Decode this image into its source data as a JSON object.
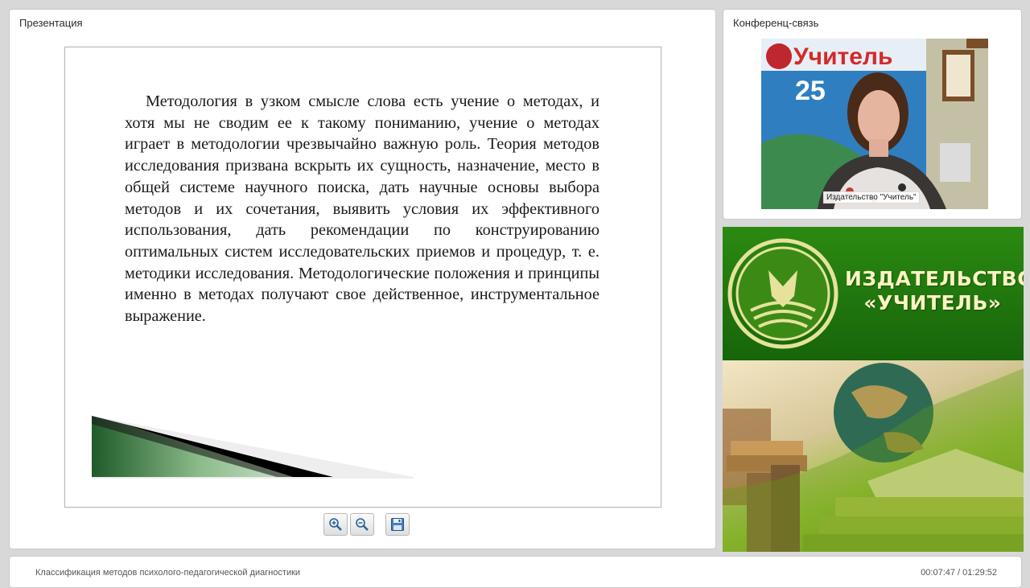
{
  "presentation": {
    "title": "Презентация",
    "slide_text": "Методология в узком смысле слова есть учение о методах, и хотя мы не сводим ее к такому пониманию, учение о методах играет в методологии чрезвычайно важную роль. Теория методов исследования призвана вскрыть их сущность, назначение, место в общей системе научного поиска, дать научные основы выбора методов и их сочетания, выявить условия их эффективного использования, дать рекомендации по конструированию оптимальных систем исследовательских приемов и процедур, т. е. методики исследования. Методологические положения и принципы именно в методах получают свое действенное, инструментальное выражение.",
    "toolbar": [
      {
        "name": "zoom-in",
        "icon": "zoom-in-icon"
      },
      {
        "name": "zoom-out",
        "icon": "zoom-out-icon"
      },
      {
        "name": "save",
        "icon": "save-icon"
      }
    ]
  },
  "conference": {
    "title": "Конференц-связь",
    "video_label": "Издательство \"Учитель\"",
    "poster_text": "Учитель",
    "poster_number": "25"
  },
  "banner": {
    "line1": "ИЗДАТЕЛЬСТВО",
    "line2": "«УЧИТЕЛЬ»",
    "colors": {
      "green": "#1f7a0d",
      "text": "#fbf3c2"
    }
  },
  "footer": {
    "lecture_title": "Классификация методов психолого-педагогической диагностики",
    "time": "00:07:47 / 01:29:52"
  }
}
